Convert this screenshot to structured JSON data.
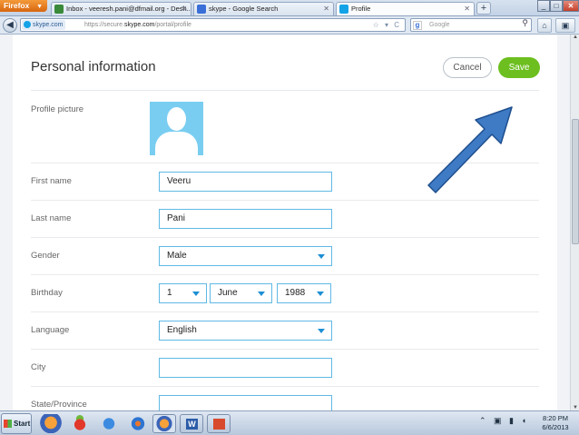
{
  "browser": {
    "menu_button": "Firefox",
    "tabs": [
      {
        "label": "Inbox - veeresh.pani@dfmail.org - Desh...",
        "icon": "gmail-icon",
        "active": false
      },
      {
        "label": "skype - Google Search",
        "icon": "google-icon",
        "active": false
      },
      {
        "label": "Profile",
        "icon": "skype-icon",
        "active": true
      }
    ],
    "site_identity": "skype.com",
    "url_prefix": "https://secure.",
    "url_domain": "skype.com",
    "url_path": "/portal/profile",
    "search_placeholder": "Google",
    "window_controls": [
      "_",
      "□",
      "✕"
    ]
  },
  "page": {
    "title": "Personal information",
    "cancel_label": "Cancel",
    "save_label": "Save",
    "fields": {
      "profile_picture_label": "Profile picture",
      "first_name_label": "First name",
      "first_name_value": "Veeru",
      "last_name_label": "Last name",
      "last_name_value": "Pani",
      "gender_label": "Gender",
      "gender_value": "Male",
      "birthday_label": "Birthday",
      "birthday_day": "1",
      "birthday_month": "June",
      "birthday_year": "1988",
      "language_label": "Language",
      "language_value": "English",
      "city_label": "City",
      "city_value": "",
      "state_label": "State/Province",
      "state_value": ""
    },
    "annotation_color": "#3f7ac4",
    "accent_green": "#6cbf1f",
    "field_border": "#5fb9e6"
  },
  "taskbar": {
    "start_label": "Start",
    "apps": [
      "firefox-icon",
      "mozilla-icon",
      "ie-icon",
      "media-player-icon",
      "firefox-icon",
      "word-icon",
      "pdf-icon"
    ],
    "time": "8:20 PM",
    "date": "6/6/2013"
  }
}
